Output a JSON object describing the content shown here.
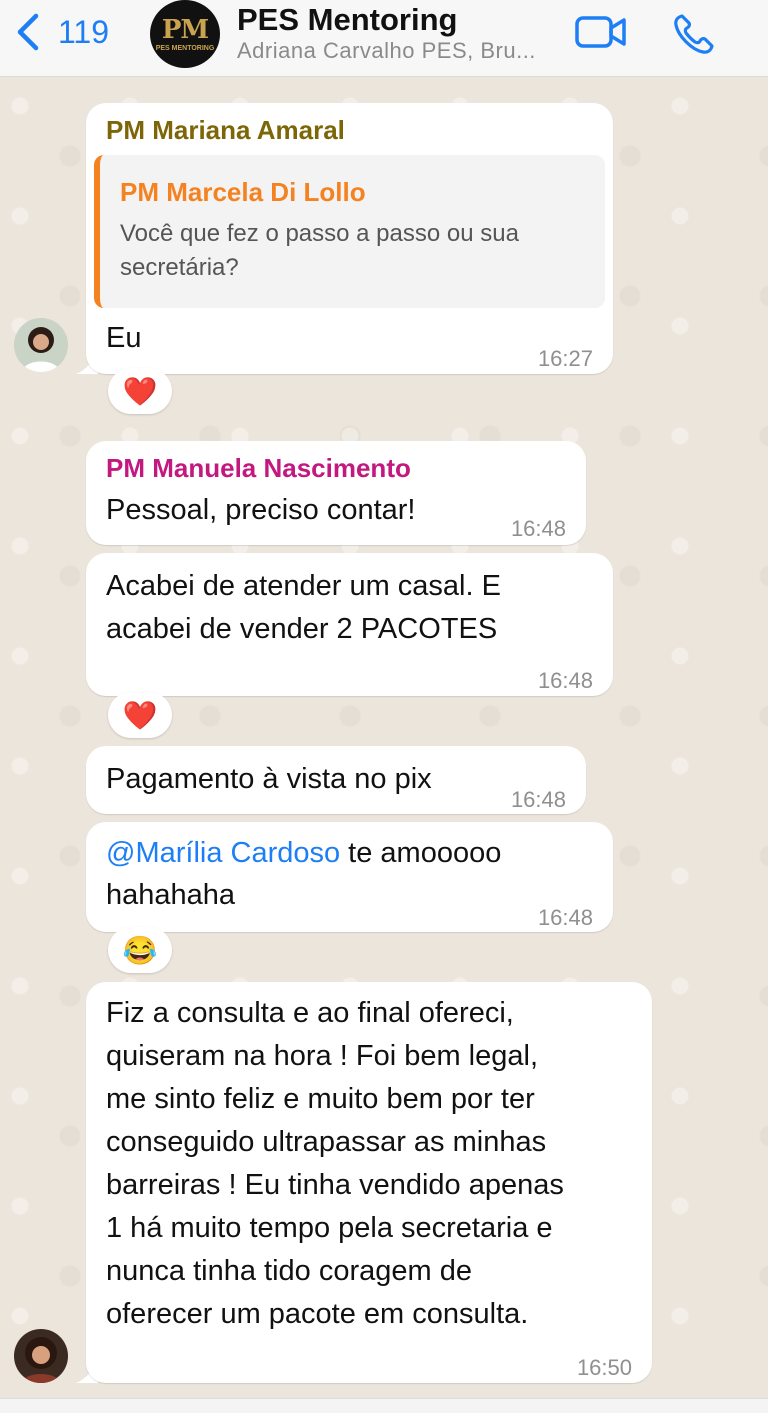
{
  "header": {
    "back_count": "119",
    "avatar_monogram": "PM",
    "avatar_text": "PES MENTORING",
    "title": "PES Mentoring",
    "subtitle": "Adriana Carvalho PES, Bru..."
  },
  "colors": {
    "accent_blue": "#1d7ef5",
    "mariana": "#7d6608",
    "marcela": "#f58220",
    "manuela": "#c2187f"
  },
  "messages": {
    "m1": {
      "sender": "PM Mariana Amaral",
      "quote_sender": "PM Marcela Di Lollo",
      "quote_line1": "Você que fez o passo a passo ou sua",
      "quote_line2": "secretária?",
      "text": "Eu",
      "time": "16:27",
      "reaction": "❤️"
    },
    "m2": {
      "sender": "PM Manuela Nascimento",
      "text": "Pessoal, preciso contar!",
      "time": "16:48"
    },
    "m3": {
      "line1": "Acabei de atender um casal. E",
      "line2": "acabei de vender 2 PACOTES",
      "time": "16:48",
      "reaction": "❤️"
    },
    "m4": {
      "text": "Pagamento à vista no pix",
      "time": "16:48"
    },
    "m5": {
      "mention": "@Marília Cardoso",
      "rest": " te amooooo",
      "line2": "hahahaha",
      "time": "16:48",
      "reaction": "😂"
    },
    "m6": {
      "lines": [
        "Fiz a consulta e ao final ofereci,",
        "quiseram na hora ! Foi bem legal,",
        "me sinto feliz e muito bem por ter",
        "conseguido ultrapassar as minhas",
        "barreiras ! Eu tinha vendido apenas",
        "1 há muito tempo pela secretaria e",
        "nunca tinha tido coragem de",
        "oferecer um pacote em consulta."
      ],
      "time": "16:50"
    }
  }
}
